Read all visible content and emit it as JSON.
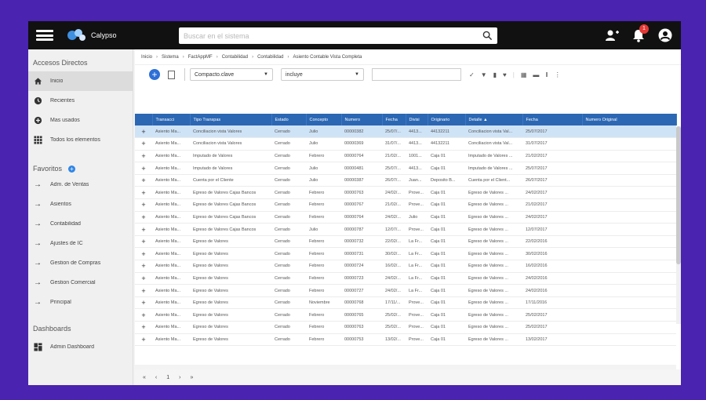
{
  "app": {
    "name": "Calypso"
  },
  "search": {
    "placeholder": "Buscar en el sistema"
  },
  "topbar": {
    "notification_count": "1"
  },
  "sidebar": {
    "direct_access_title": "Accesos Directos",
    "direct_items": [
      {
        "label": "Inicio",
        "icon": "home-icon"
      },
      {
        "label": "Recientes",
        "icon": "clock-icon"
      },
      {
        "label": "Mas usados",
        "icon": "plus-circle-icon"
      },
      {
        "label": "Todos los elementos",
        "icon": "grid-icon"
      }
    ],
    "favorites_title": "Favoritos",
    "favorite_items": [
      {
        "label": "Adm. de Ventas"
      },
      {
        "label": "Asientos"
      },
      {
        "label": "Contabilidad"
      },
      {
        "label": "Ajustes de IC"
      },
      {
        "label": "Gestion de Compras"
      },
      {
        "label": "Gestion Comercial"
      },
      {
        "label": "Principal"
      }
    ],
    "dashboards_title": "Dashboards",
    "dashboard_items": [
      {
        "label": "Admin Dashboard"
      }
    ]
  },
  "breadcrumb": [
    "Inicio",
    "Sistema",
    "FactAppMF",
    "Contabilidad",
    "Contabilidad",
    "Asiento Contable Vista Completa"
  ],
  "toolbar": {
    "view_select": "Compacto.clave",
    "filter_select": "incluye",
    "filter_value": ""
  },
  "table": {
    "columns": [
      "",
      "Transacci",
      "Tipo Transpas",
      "Estado",
      "Concepto",
      "Numero",
      "Fecha",
      "Divisi",
      "Originario",
      "Detalle ▲",
      "Fecha",
      "Numero Original"
    ],
    "rows": [
      [
        "+",
        "Asiento Ma...",
        "Conciliacion vista Valores",
        "Cerrado",
        "Julio",
        "00000382",
        "25/07/...",
        "4413...",
        "44132211",
        "Conciliacion vista Val...",
        "25/07/2017",
        ""
      ],
      [
        "+",
        "Asiento Ma...",
        "Conciliacion vista Valores",
        "Cerrado",
        "Julio",
        "00000369",
        "31/07/...",
        "4413...",
        "44132211",
        "Conciliacion vista Val...",
        "31/07/2017",
        ""
      ],
      [
        "+",
        "Asiento Ma...",
        "Imputado de Valores",
        "Cerrado",
        "Febrero",
        "00000764",
        "21/02/...",
        "1001...",
        "Caja 01",
        "Imputado de Valores ...",
        "21/02/2017",
        ""
      ],
      [
        "+",
        "Asiento Ma...",
        "Imputado de Valores",
        "Cerrado",
        "Julio",
        "00000481",
        "25/07/...",
        "4413...",
        "Caja 01",
        "Imputado de Valores ...",
        "25/07/2017",
        ""
      ],
      [
        "+",
        "Asiento Ma...",
        "Cuenta por el Cliente",
        "Cerrado",
        "Julio",
        "00000387",
        "26/07/...",
        "Juan...",
        "Deposito B...",
        "Cuenta por el Client...",
        "26/07/2017",
        ""
      ],
      [
        "+",
        "Asiento Ma...",
        "Egreso de Valores Cajas Bancos",
        "Cerrado",
        "Febrero",
        "00000763",
        "24/02/...",
        "Prove...",
        "Caja 01",
        "Egreso de Valores ...",
        "24/02/2017",
        ""
      ],
      [
        "+",
        "Asiento Ma...",
        "Egreso de Valores Cajas Bancos",
        "Cerrado",
        "Febrero",
        "00000767",
        "21/02/...",
        "Prove...",
        "Caja 01",
        "Egreso de Valores ...",
        "21/02/2017",
        ""
      ],
      [
        "+",
        "Asiento Ma...",
        "Egreso de Valores Cajas Bancos",
        "Cerrado",
        "Febrero",
        "00000764",
        "24/02/...",
        "Julio",
        "Caja 01",
        "Egreso de Valores ...",
        "24/02/2017",
        ""
      ],
      [
        "+",
        "Asiento Ma...",
        "Egreso de Valores Cajas Bancos",
        "Cerrado",
        "Julio",
        "00000787",
        "12/07/...",
        "Prove...",
        "Caja 01",
        "Egreso de Valores ...",
        "12/07/2017",
        ""
      ],
      [
        "+",
        "Asiento Ma...",
        "Egreso de Valores",
        "Cerrado",
        "Febrero",
        "00000732",
        "22/02/...",
        "La Fr...",
        "Caja 01",
        "Egreso de Valores ...",
        "22/02/2016",
        ""
      ],
      [
        "+",
        "Asiento Ma...",
        "Egreso de Valores",
        "Cerrado",
        "Febrero",
        "00000731",
        "30/02/...",
        "La Fr...",
        "Caja 01",
        "Egreso de Valores ...",
        "30/02/2016",
        ""
      ],
      [
        "+",
        "Asiento Ma...",
        "Egreso de Valores",
        "Cerrado",
        "Febrero",
        "00000724",
        "16/02/...",
        "La Fr...",
        "Caja 01",
        "Egreso de Valores ...",
        "16/02/2016",
        ""
      ],
      [
        "+",
        "Asiento Ma...",
        "Egreso de Valores",
        "Cerrado",
        "Febrero",
        "00000723",
        "24/02/...",
        "La Fr...",
        "Caja 01",
        "Egreso de Valores ...",
        "24/02/2016",
        ""
      ],
      [
        "+",
        "Asiento Ma...",
        "Egreso de Valores",
        "Cerrado",
        "Febrero",
        "00000727",
        "24/02/...",
        "La Fr...",
        "Caja 01",
        "Egreso de Valores ...",
        "24/02/2016",
        ""
      ],
      [
        "+",
        "Asiento Ma...",
        "Egreso de Valores",
        "Cerrado",
        "Noviembre",
        "00000768",
        "17/11/...",
        "Prove...",
        "Caja 01",
        "Egreso de Valores ...",
        "17/11/2016",
        ""
      ],
      [
        "+",
        "Asiento Ma...",
        "Egreso de Valores",
        "Cerrado",
        "Febrero",
        "00000765",
        "25/02/...",
        "Prove...",
        "Caja 01",
        "Egreso de Valores ...",
        "25/02/2017",
        ""
      ],
      [
        "+",
        "Asiento Ma...",
        "Egreso de Valores",
        "Cerrado",
        "Febrero",
        "00000763",
        "25/02/...",
        "Prove...",
        "Caja 01",
        "Egreso de Valores ...",
        "25/02/2017",
        ""
      ],
      [
        "+",
        "Asiento Ma...",
        "Egreso de Valores",
        "Cerrado",
        "Febrero",
        "00000753",
        "13/02/...",
        "Prove...",
        "Caja 01",
        "Egreso de Valores ...",
        "13/02/2017",
        ""
      ]
    ]
  },
  "pager": {
    "first": "«",
    "prev": "‹",
    "page": "1",
    "next": "›",
    "last": "»"
  },
  "colors": {
    "background": "#4a23b0",
    "topbar": "#111111",
    "table_header": "#2b67b3",
    "accent": "#2f6fd6",
    "badge": "#e53935"
  }
}
